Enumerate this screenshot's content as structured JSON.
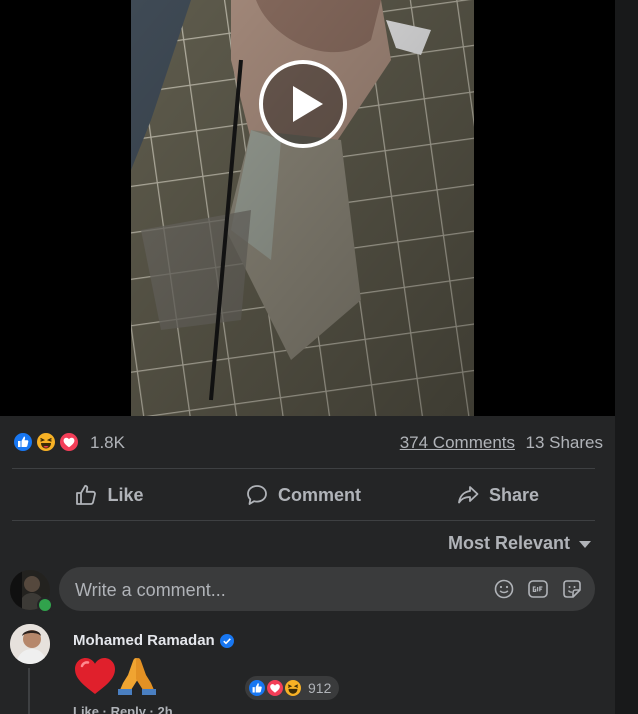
{
  "reactions_summary": {
    "icons": [
      "like-icon",
      "haha-icon",
      "love-icon"
    ],
    "count": "1.8K",
    "comments": "374 Comments",
    "shares": "13 Shares"
  },
  "actions": {
    "like": "Like",
    "comment": "Comment",
    "share": "Share"
  },
  "sort": {
    "selected": "Most Relevant"
  },
  "composer": {
    "placeholder": "Write a comment...",
    "icons": [
      "emoji-icon",
      "gif-icon",
      "sticker-icon"
    ]
  },
  "comments": [
    {
      "author": "Mohamed Ramadan",
      "verified": true,
      "content_icons": [
        "red-heart-icon",
        "folded-hands-icon"
      ],
      "reaction_icons": [
        "like-icon",
        "love-icon",
        "haha-icon"
      ],
      "reaction_count": "912",
      "meta": "Like · Reply · 2h"
    }
  ],
  "colors": {
    "post_bg": "#242526",
    "text_secondary": "#b0b3b8",
    "like_blue": "#1877f2",
    "love_red": "#f33e58",
    "haha_yellow": "#f7b125",
    "online_green": "#31a24c"
  }
}
